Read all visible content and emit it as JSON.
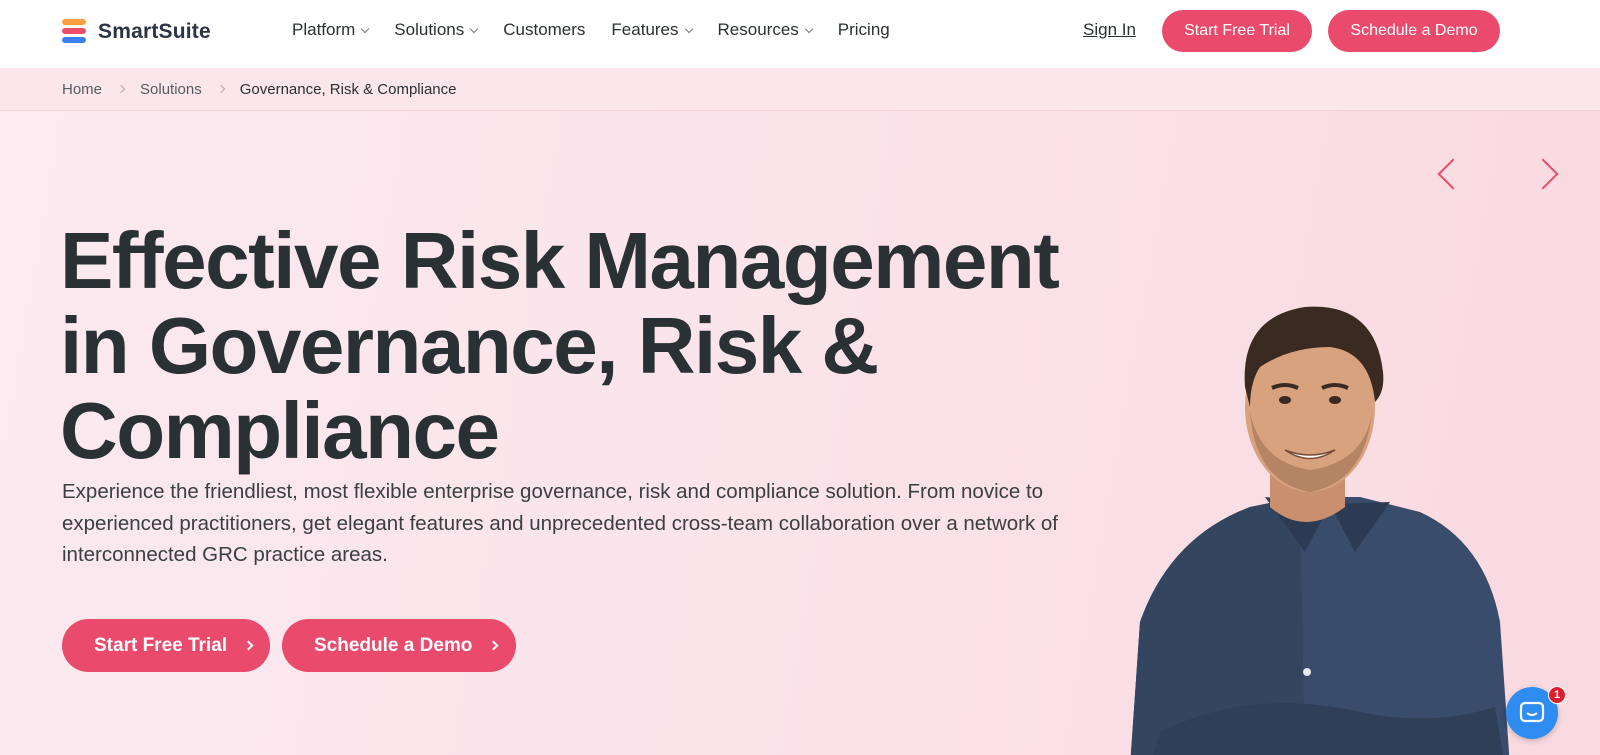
{
  "brand": {
    "name": "SmartSuite"
  },
  "nav": {
    "items": [
      {
        "label": "Platform",
        "has_dropdown": true
      },
      {
        "label": "Solutions",
        "has_dropdown": true
      },
      {
        "label": "Customers",
        "has_dropdown": false
      },
      {
        "label": "Features",
        "has_dropdown": true
      },
      {
        "label": "Resources",
        "has_dropdown": true
      },
      {
        "label": "Pricing",
        "has_dropdown": false
      }
    ],
    "sign_in": "Sign In",
    "trial_label": "Start Free Trial",
    "demo_label": "Schedule a Demo"
  },
  "breadcrumb": {
    "home": "Home",
    "solutions": "Solutions",
    "current": "Governance, Risk & Compliance"
  },
  "hero": {
    "title_line1": "Effective Risk Management",
    "title_line2": "in Governance, Risk &",
    "title_line3": "Compliance",
    "description": "Experience the friendliest, most flexible enterprise governance, risk and compliance solution. From novice to experienced practitioners, get elegant features and unprecedented cross-team collaboration over a network of interconnected GRC practice areas.",
    "cta_trial": "Start Free Trial",
    "cta_demo": "Schedule a Demo"
  },
  "chat": {
    "badge_count": "1"
  },
  "colors": {
    "accent": "#ea4b6c",
    "hero_bg": "#fbe6ec",
    "text": "#2b3033",
    "chat": "#2f8cf0"
  }
}
